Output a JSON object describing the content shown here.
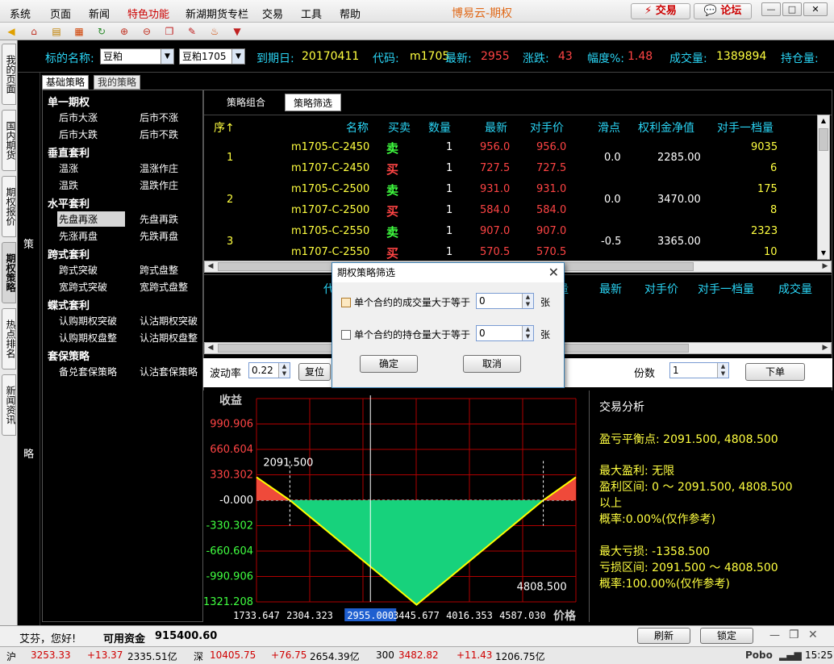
{
  "menu": {
    "items": [
      "系统",
      "页面",
      "新闻",
      "特色功能",
      "新湖期货专栏",
      "交易",
      "工具",
      "帮助"
    ],
    "active_index": 3,
    "app_title": "博易云-期权",
    "trade_button": "交易",
    "forum_button": "论坛"
  },
  "left_tabs": [
    "我的页面",
    "国内期货",
    "期权报价",
    "期权策略",
    "热点排名",
    "新闻资讯"
  ],
  "left_tab_active": 3,
  "quote": {
    "underlying_label": "标的名称:",
    "underlying_value": "豆粕",
    "contract_value": "豆粕1705",
    "expiry_label": "到期日:",
    "expiry_value": "20170411",
    "code_label": "代码:",
    "code_value": "m1705",
    "last_label": "最新:",
    "last_value": "2955",
    "change_label": "涨跌:",
    "change_value": "43",
    "pct_label": "幅度%:",
    "pct_value": "1.48",
    "volume_label": "成交量:",
    "volume_value": "1389894",
    "oi_label": "持仓量:"
  },
  "side_chars": [
    "策",
    "略"
  ],
  "tree": {
    "tabs": [
      "基础策略",
      "我的策略"
    ],
    "categories": [
      {
        "name": "单一期权",
        "items": [
          [
            "后市大涨",
            "后市不涨"
          ],
          [
            "后市大跌",
            "后市不跌"
          ]
        ]
      },
      {
        "name": "垂直套利",
        "items": [
          [
            "温涨",
            "温涨作庄"
          ],
          [
            "温跌",
            "温跌作庄"
          ]
        ]
      },
      {
        "name": "水平套利",
        "items": [
          [
            "先盘再涨",
            "先盘再跌"
          ],
          [
            "先涨再盘",
            "先跌再盘"
          ]
        ]
      },
      {
        "name": "跨式套利",
        "items": [
          [
            "跨式突破",
            "跨式盘整"
          ],
          [
            "宽跨式突破",
            "宽跨式盘整"
          ]
        ]
      },
      {
        "name": "蝶式套利",
        "items": [
          [
            "认购期权突破",
            "认沽期权突破"
          ],
          [
            "认购期权盘整",
            "认沽期权盘整"
          ]
        ]
      },
      {
        "name": "套保策略",
        "items": [
          [
            "备兑套保策略",
            "认沽套保策略"
          ]
        ]
      }
    ],
    "selected": "先盘再涨"
  },
  "subtabs": [
    "策略组合",
    "策略筛选"
  ],
  "table": {
    "headers": [
      "序↑",
      "名称",
      "买卖",
      "数量",
      "最新",
      "对手价",
      "滑点",
      "权利金净值",
      "对手一档量"
    ],
    "rows": [
      {
        "seq": "1",
        "slip": "0.0",
        "premium": "2285.00",
        "legs": [
          {
            "name": "m1705-C-2450",
            "side": "卖",
            "qty": "1",
            "last": "956.0",
            "opp": "956.0",
            "lvl": "9035"
          },
          {
            "name": "m1707-C-2450",
            "side": "买",
            "qty": "1",
            "last": "727.5",
            "opp": "727.5",
            "lvl": "6"
          }
        ]
      },
      {
        "seq": "2",
        "slip": "0.0",
        "premium": "3470.00",
        "legs": [
          {
            "name": "m1705-C-2500",
            "side": "卖",
            "qty": "1",
            "last": "931.0",
            "opp": "931.0",
            "lvl": "175"
          },
          {
            "name": "m1707-C-2500",
            "side": "买",
            "qty": "1",
            "last": "584.0",
            "opp": "584.0",
            "lvl": "8"
          }
        ]
      },
      {
        "seq": "3",
        "slip": "-0.5",
        "premium": "3365.00",
        "legs": [
          {
            "name": "m1705-C-2550",
            "side": "卖",
            "qty": "1",
            "last": "907.0",
            "opp": "907.0",
            "lvl": "2323"
          },
          {
            "name": "m1707-C-2550",
            "side": "买",
            "qty": "1",
            "last": "570.5",
            "opp": "570.5",
            "lvl": "10"
          }
        ]
      }
    ]
  },
  "table2": {
    "headers": [
      "代",
      "量",
      "最新",
      "对手价",
      "对手一档量",
      "成交量"
    ]
  },
  "controls": {
    "vol_label": "波动率",
    "vol_value": "0.22",
    "reset_button": "复位",
    "shares_label": "份数",
    "shares_value": "1",
    "order_button": "下单"
  },
  "dialog": {
    "title": "期权策略筛选",
    "row1_label": "单个合约的成交量大于等于",
    "row1_value": "0",
    "row1_unit": "张",
    "row2_label": "单个合约的持仓量大于等于",
    "row2_value": "0",
    "row2_unit": "张",
    "ok": "确定",
    "cancel": "取消"
  },
  "chart_data": {
    "type": "area",
    "ylabel": "收益",
    "xlabel": "价格",
    "y_ticks": [
      "990.906",
      "660.604",
      "330.302",
      "-0.000",
      "-330.302",
      "-660.604",
      "-990.906",
      "-1321.208"
    ],
    "x_ticks": [
      "1733.647",
      "2304.323",
      "2955.000",
      "3445.677",
      "4016.353",
      "4587.030"
    ],
    "x_highlight": "2955.000",
    "annotations": [
      "2091.500",
      "4808.500"
    ],
    "xlim": [
      1733.647,
      5158
    ],
    "ylim": [
      -1321.208,
      1321.208
    ],
    "x": [
      1733.647,
      2091.5,
      3450,
      4808.5,
      5158
    ],
    "y": [
      300,
      0,
      -1358.5,
      0,
      300
    ],
    "colors": {
      "profit": "#ef4a3a",
      "loss": "#17d27c",
      "line": "#ffff00",
      "grid": "#b00000"
    }
  },
  "analysis": {
    "title": "交易分析",
    "lines": [
      "盈亏平衡点: 2091.500, 4808.500",
      "",
      "最大盈利: 无限",
      "盈利区间: 0 ～ 2091.500, 4808.500",
      "以上",
      "概率:0.00%(仅作参考)",
      "",
      "最大亏损: -1358.500",
      "亏损区间: 2091.500 ～ 4808.500",
      "概率:100.00%(仅作参考)"
    ]
  },
  "status": {
    "greeting": "艾芬，您好!",
    "funds_label": "可用资金",
    "funds_value": "915400.60",
    "refresh": "刷新",
    "lock": "锁定"
  },
  "index_bar": {
    "sh_label": "沪",
    "sh_value": "3253.33",
    "sh_change": "+13.37",
    "sh_amount": "2335.51亿",
    "sz_label": "深",
    "sz_value": "10405.75",
    "sz_change": "+76.75",
    "sz_amount": "2654.39亿",
    "hs_label": "300",
    "hs_value": "3482.82",
    "hs_change": "+11.43",
    "hs_amount": "1206.75亿",
    "brand": "Pobo",
    "time": "15:25"
  }
}
